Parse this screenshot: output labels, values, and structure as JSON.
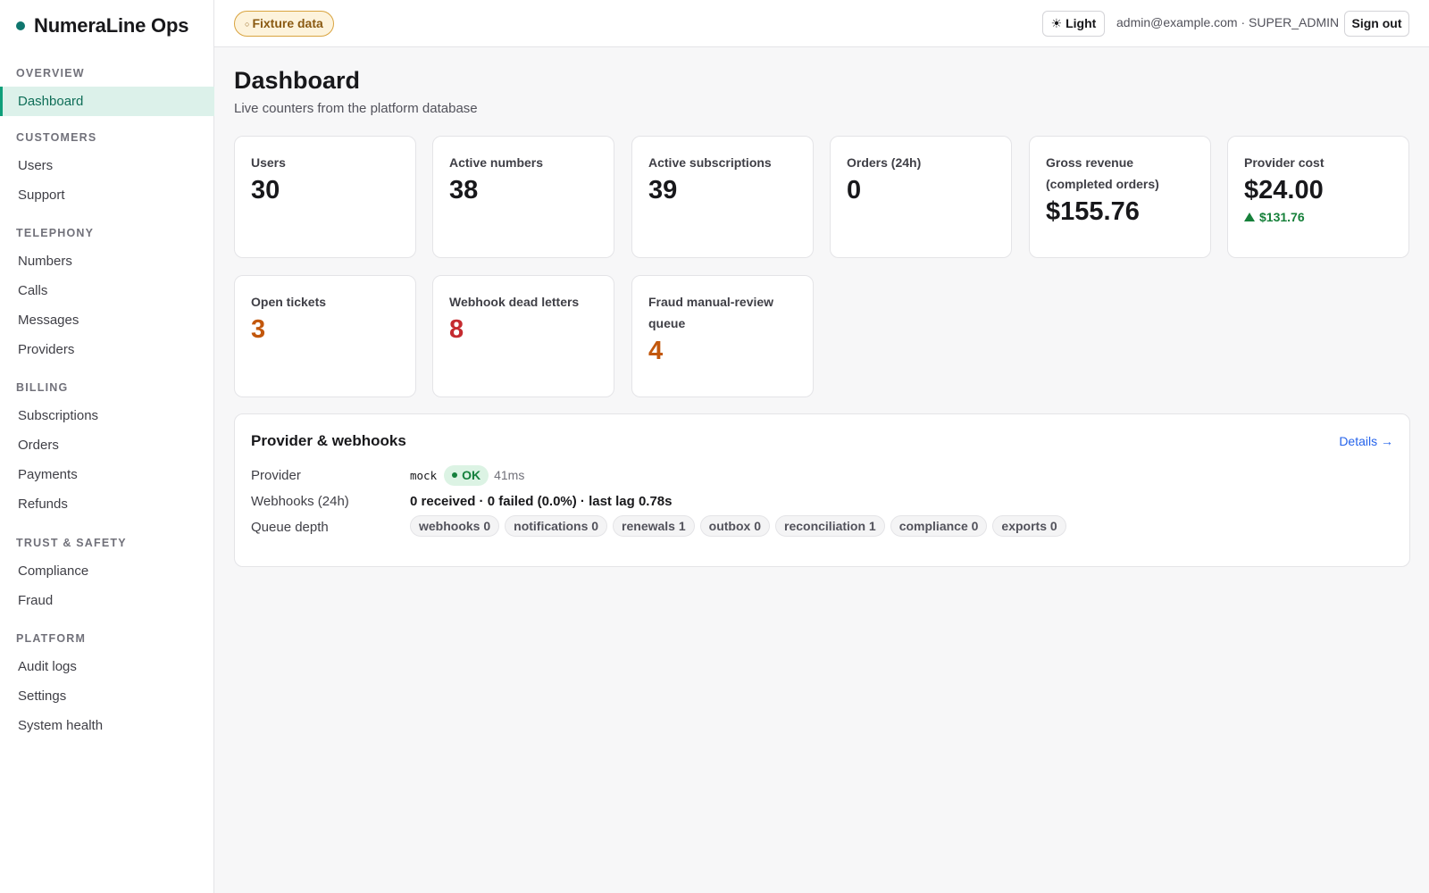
{
  "app": {
    "brand": "NumeraLine Ops"
  },
  "sidebar": {
    "sections": [
      {
        "title": "OVERVIEW",
        "items": [
          {
            "label": "Dashboard",
            "active": true
          }
        ]
      },
      {
        "title": "CUSTOMERS",
        "items": [
          {
            "label": "Users"
          },
          {
            "label": "Support"
          }
        ]
      },
      {
        "title": "TELEPHONY",
        "items": [
          {
            "label": "Numbers"
          },
          {
            "label": "Calls"
          },
          {
            "label": "Messages"
          },
          {
            "label": "Providers"
          }
        ]
      },
      {
        "title": "BILLING",
        "items": [
          {
            "label": "Subscriptions"
          },
          {
            "label": "Orders"
          },
          {
            "label": "Payments"
          },
          {
            "label": "Refunds"
          }
        ]
      },
      {
        "title": "TRUST & SAFETY",
        "items": [
          {
            "label": "Compliance"
          },
          {
            "label": "Fraud"
          }
        ]
      },
      {
        "title": "PLATFORM",
        "items": [
          {
            "label": "Audit logs"
          },
          {
            "label": "Settings"
          },
          {
            "label": "System health"
          }
        ]
      }
    ]
  },
  "header": {
    "fixture_badge": "Fixture data",
    "theme_label": "Light",
    "user": "admin@example.com · SUPER_ADMIN",
    "signout_label": "Sign out"
  },
  "page": {
    "title": "Dashboard",
    "subtitle": "Live counters from the platform database"
  },
  "stats": [
    {
      "label": "Users",
      "value": "30"
    },
    {
      "label": "Active numbers",
      "value": "38"
    },
    {
      "label": "Active subscriptions",
      "value": "39"
    },
    {
      "label": "Orders (24h)",
      "value": "0"
    },
    {
      "label": "Gross revenue (completed orders)",
      "value": "$155.76"
    },
    {
      "label": "Provider cost",
      "value": "$24.00",
      "delta": "$131.76"
    },
    {
      "label": "Open tickets",
      "value": "3",
      "tone": "orange"
    },
    {
      "label": "Webhook dead letters",
      "value": "8",
      "tone": "red"
    },
    {
      "label": "Fraud manual-review queue",
      "value": "4",
      "tone": "orange"
    }
  ],
  "provider_panel": {
    "title": "Provider & webhooks",
    "details_link": "Details →",
    "provider_label": "Provider",
    "provider_name": "mock",
    "provider_status": "OK",
    "provider_latency": "41ms",
    "webhooks_label": "Webhooks (24h)",
    "webhooks_summary": "0 received · 0 failed (0.0%) · last lag 0.78s",
    "queue_label": "Queue depth",
    "queues": [
      "webhooks 0",
      "notifications 0",
      "renewals 1",
      "outbox 0",
      "reconciliation 1",
      "compliance 0",
      "exports 0"
    ]
  },
  "colors": {
    "accent": "#0f766e",
    "active_nav_bg": "#dcf1ea",
    "warning": "#c2570c",
    "danger": "#c52b30",
    "success": "#15803d",
    "link": "#2563eb"
  }
}
